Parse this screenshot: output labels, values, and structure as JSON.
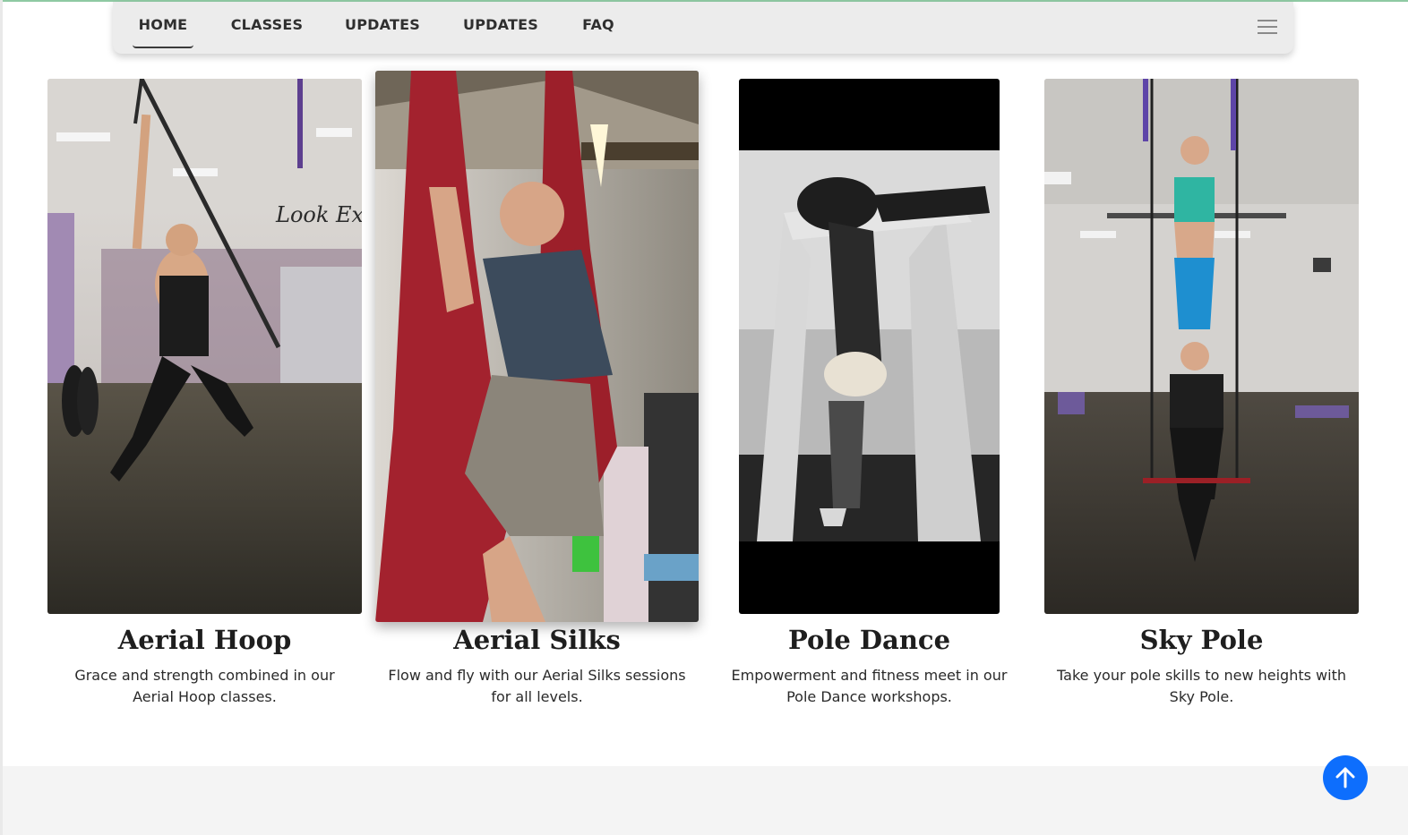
{
  "nav": {
    "items": [
      {
        "label": "HOME",
        "active": true
      },
      {
        "label": "CLASSES",
        "active": false
      },
      {
        "label": "UPDATES",
        "active": false
      },
      {
        "label": "UPDATES",
        "active": false
      },
      {
        "label": "FAQ",
        "active": false
      }
    ],
    "menu_icon": "hamburger-menu-icon"
  },
  "cards": [
    {
      "title": "Aerial Hoop",
      "description": "Grace and strength combined in our Aerial Hoop classes.",
      "image": "aerial-hoop-photo"
    },
    {
      "title": "Aerial Silks",
      "description": "Flow and fly with our Aerial Silks sessions for all levels.",
      "image": "aerial-silks-photo"
    },
    {
      "title": "Pole Dance",
      "description": "Empowerment and fitness meet in our Pole Dance workshops.",
      "image": "pole-dance-photo"
    },
    {
      "title": "Sky Pole",
      "description": "Take your pole skills to new heights with Sky Pole.",
      "image": "sky-pole-photo"
    }
  ],
  "scroll_top": {
    "icon": "arrow-up-icon"
  },
  "colors": {
    "accent": "#0d6efd",
    "nav_bg": "#ececec",
    "silks_red": "#a3222e"
  }
}
